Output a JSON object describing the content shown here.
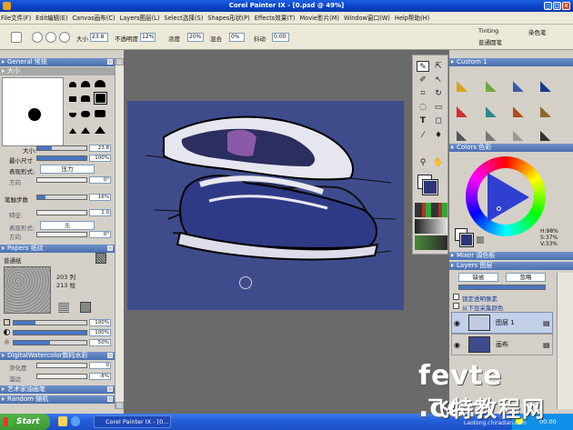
{
  "window": {
    "title": "Corel Painter IX - [0.psd @ 49%]"
  },
  "menu": [
    "File文件(F)",
    "Edit编辑(E)",
    "Canvas画布(C)",
    "Layers图层(L)",
    "Select选择(S)",
    "Shapes形状(P)",
    "Effects效果(T)",
    "Movie影片(M)",
    "Window窗口(W)",
    "Help帮助(H)"
  ],
  "propbar": {
    "size_label": "大小",
    "size_value": "23.8",
    "opacity_label": "不透明度",
    "opacity_value": "12%",
    "concentration_label": "浓度",
    "concentration_value": "20%",
    "blend_label": "混合",
    "blend_value": "0%",
    "jitter_label": "抖动",
    "jitter_value": "0.00",
    "brush_category": "Tinting",
    "brush_category_cn": "染色笔",
    "brush_variant": "普通圆笔"
  },
  "general": {
    "header": "General 常规",
    "size_section": "大小",
    "size_label": "大小:",
    "size_value": "23.8",
    "min_size_label": "最小尺寸",
    "min_size_value": "100%",
    "expression_label": "表现形式:",
    "expression_value": "压力",
    "direction_label": "方向",
    "direction_value": "0°",
    "step_label": "笔触步数",
    "step_value": "16%",
    "feature_label": "特征:",
    "feature_value": "1.0",
    "expression2_label": "表现形式:",
    "expression2_value": "无",
    "direction2_label": "方向",
    "direction2_value": "0°"
  },
  "papers": {
    "header": "Papers 纸纹",
    "name": "普通纸",
    "cols": "203 列",
    "rows": "213 柱",
    "values": [
      "100%",
      "100%",
      "50%"
    ]
  },
  "watercolor": {
    "header": "DigitalWatercolor数码水彩",
    "wet_label": "渗化度",
    "wet_value": "0",
    "edge_label": "湿边",
    "edge_value": "-8%"
  },
  "sections": {
    "artist_oils": "艺术家油画笔",
    "random": "Random 随机"
  },
  "custom": {
    "header": "Custom 1"
  },
  "colors": {
    "header": "Colors 色彩",
    "h": "H:98%",
    "s": "S:37%",
    "v": "V:33%"
  },
  "mixer": {
    "header": "Mixer 调色板"
  },
  "layers": {
    "header": "Layers 图层",
    "blend_mode": "缺省",
    "composite": "忽略",
    "preserve_label": "锁定透明像素",
    "pick_label": "从下层采集颜色",
    "items": [
      {
        "name": "图层 1"
      },
      {
        "name": "画布"
      }
    ]
  },
  "taskbar": {
    "start": "Start",
    "task": "Corel Painter IX - [0...",
    "clock": "00:00"
  },
  "watermark": {
    "line1": "fevte .com",
    "line2": "飞特教程网",
    "site": "Laotong.chiradian.com"
  },
  "colors_palette": {
    "accent": "#4a70b0",
    "paper": "#3f4c8c"
  }
}
